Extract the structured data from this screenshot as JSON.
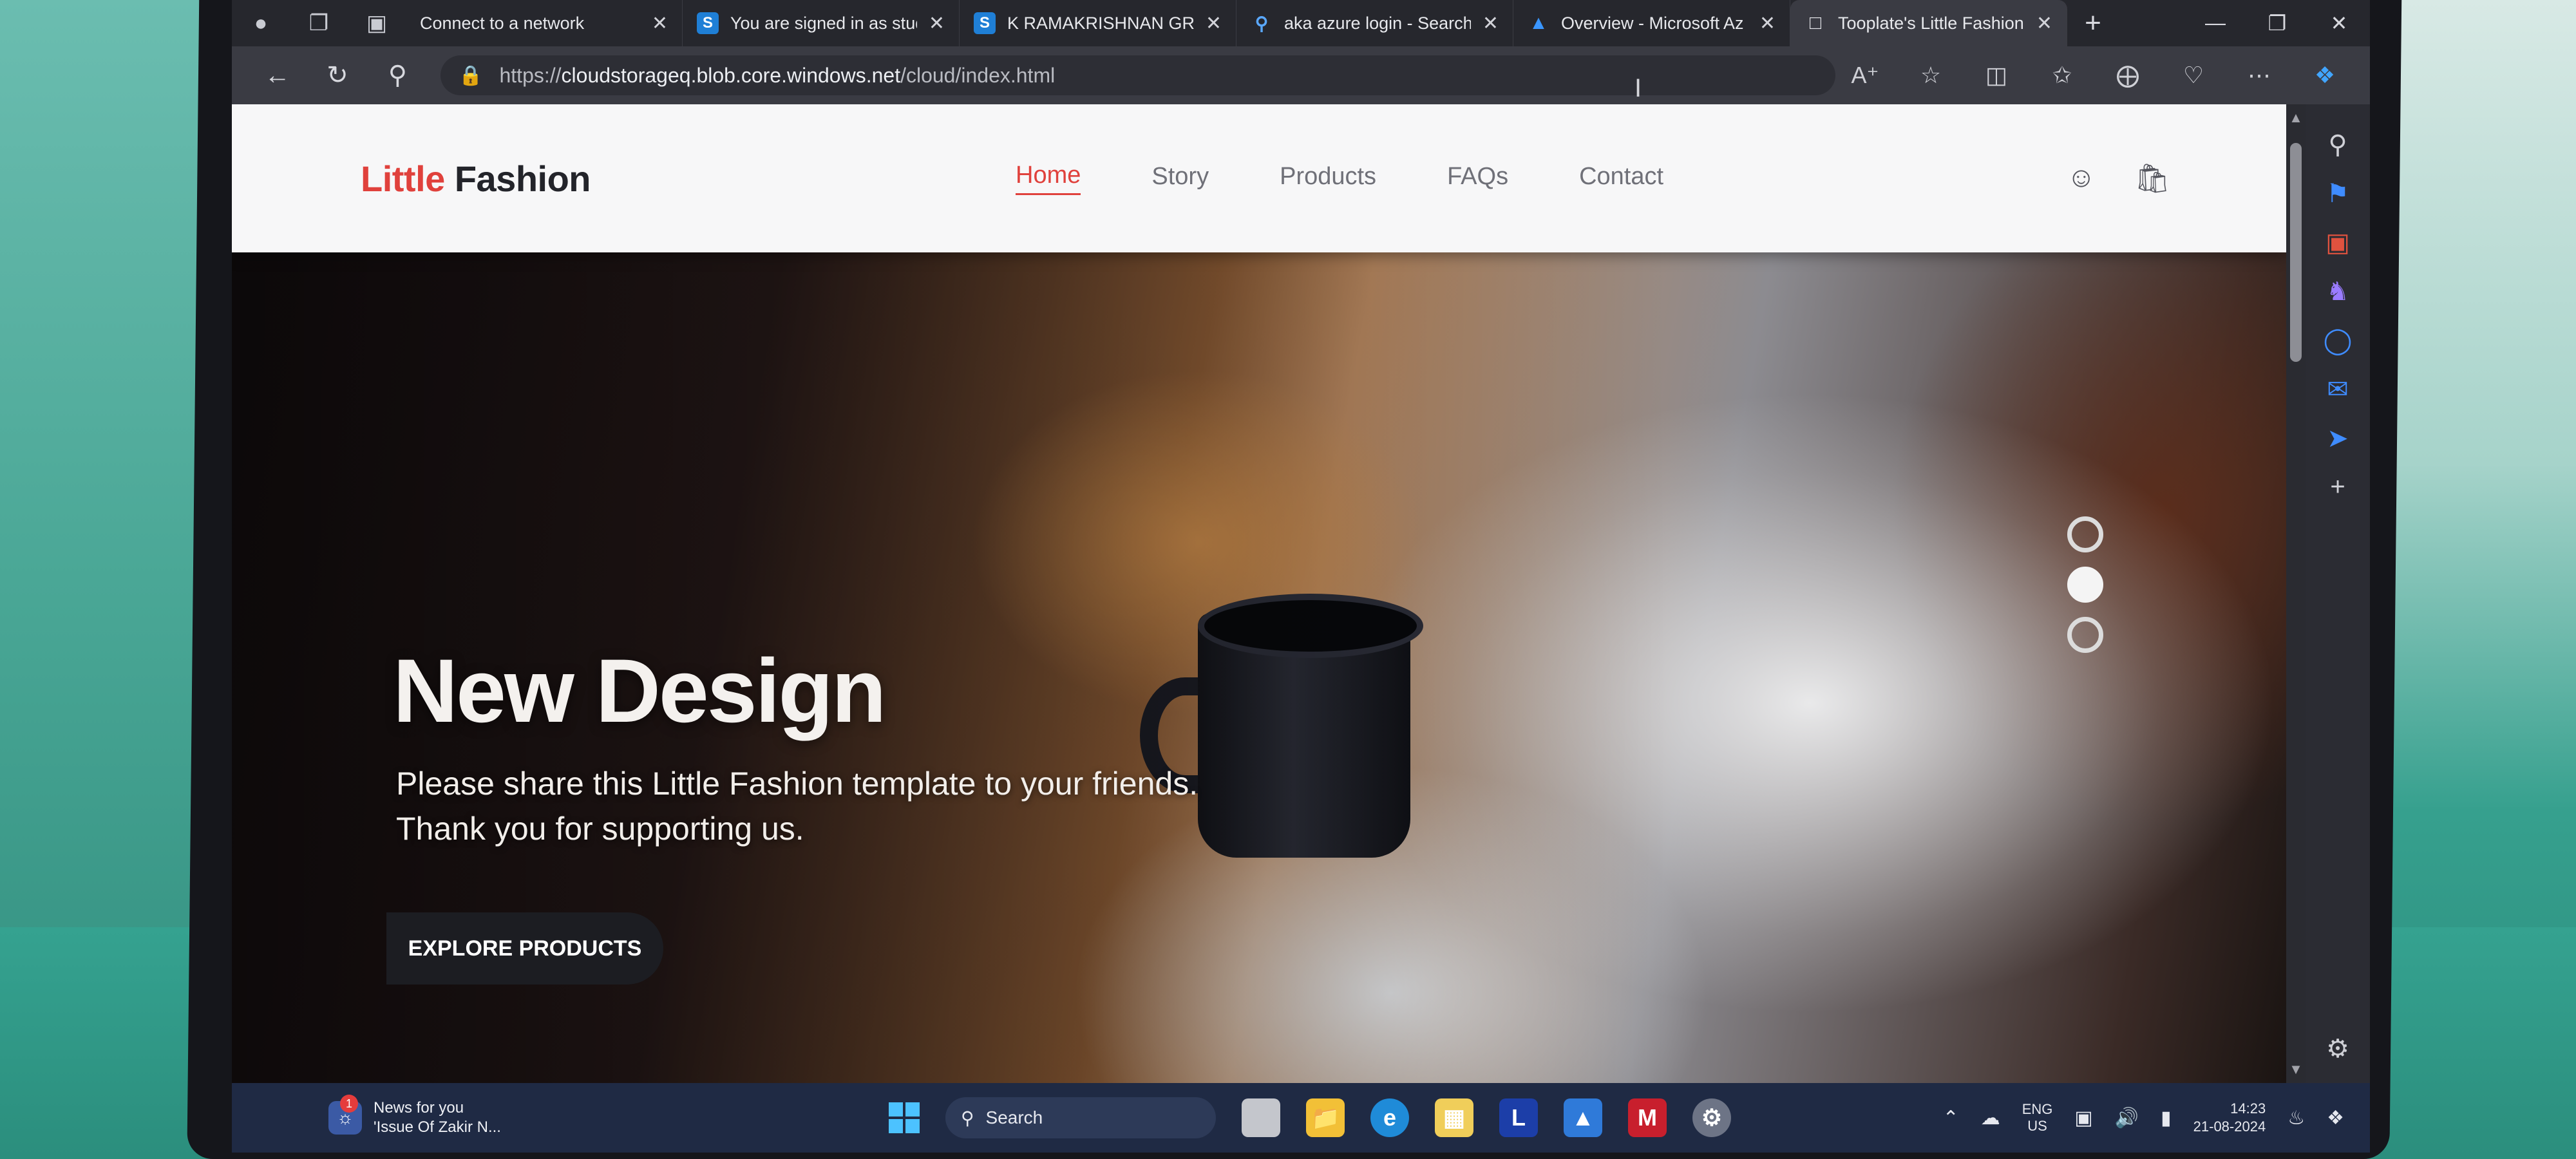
{
  "browser": {
    "tabs": [
      {
        "title": "Connect to a network",
        "icon": "none",
        "active": false
      },
      {
        "title": "You are signed in as stud",
        "icon": "s-icon",
        "active": false
      },
      {
        "title": "K RAMAKRISHNAN GRO",
        "icon": "s-icon",
        "active": false
      },
      {
        "title": "aka azure login - Search",
        "icon": "search-icon",
        "active": false
      },
      {
        "title": "Overview - Microsoft Az",
        "icon": "azure-icon",
        "active": false
      },
      {
        "title": "Tooplate's Little Fashion",
        "icon": "page-icon",
        "active": true
      }
    ],
    "url_prefix": "https://",
    "url_host": "cloudstorageq.blob.core.windows.net",
    "url_path": "/cloud/index.html"
  },
  "site": {
    "brand_accent": "Little",
    "brand_rest": "Fashion",
    "nav": [
      "Home",
      "Story",
      "Products",
      "FAQs",
      "Contact"
    ],
    "active_nav": "Home",
    "accent_color": "#e0413c",
    "hero": {
      "title": "New Design",
      "line1": "Please share this Little Fashion template to your friends.",
      "line2": "Thank you for supporting us.",
      "button": "EXPLORE PRODUCTS",
      "slides": 3,
      "active_slide": 2
    }
  },
  "taskbar": {
    "news_title": "News for you",
    "news_subtitle": "'Issue Of Zakir N...",
    "news_badge": "1",
    "search_label": "Search",
    "apps": [
      "file-explorer-icon",
      "edge-icon",
      "store-icon",
      "l-app-icon",
      "azure-storage-icon",
      "mcafee-icon",
      "settings-icon"
    ],
    "lang_top": "ENG",
    "lang_bottom": "US",
    "time": "14:23",
    "date": "21-08-2024"
  }
}
